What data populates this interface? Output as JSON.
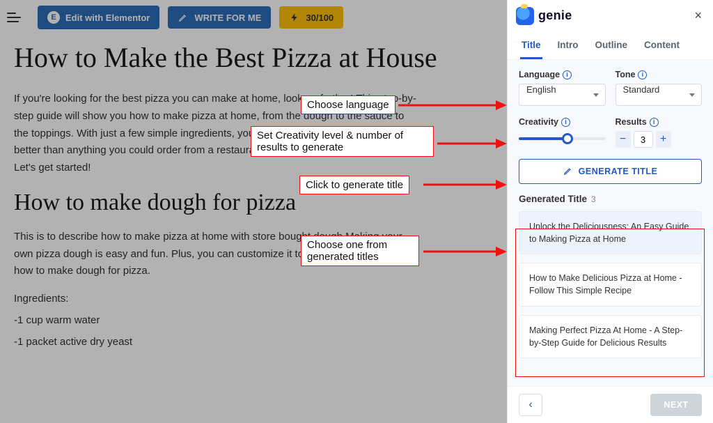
{
  "topbar": {
    "elementor_label": "Edit with Elementor",
    "write_label": "WRITE FOR ME",
    "credits_label": "30/100"
  },
  "article": {
    "title": "How to Make the Best Pizza at House",
    "intro": "If you're looking for the best pizza you can make at home, look no further! This step-by-step guide will show you how to make pizza at home, from the dough to the sauce to the toppings. With just a few simple ingredients, you can have a delicious pizza that's better than anything you could order from a restaurant. So what are you waiting for? Let's get started!",
    "h2": "How to make dough for pizza",
    "p2": "This is to describe how to make pizza at home with store bought dough Making your own pizza dough is easy and fun. Plus, you can customize it to your own taste. Here's how to make dough for pizza.",
    "ing_label": "Ingredients:",
    "ing1": "-1 cup warm water",
    "ing2": "-1 packet active dry yeast"
  },
  "panel": {
    "logo_text": "genie",
    "tabs": {
      "title": "Title",
      "intro": "Intro",
      "outline": "Outline",
      "content": "Content"
    },
    "language_label": "Language",
    "language_value": "English",
    "tone_label": "Tone",
    "tone_value": "Standard",
    "creativity_label": "Creativity",
    "creativity_value": 3,
    "creativity_max": 5,
    "results_label": "Results",
    "results_value": "3",
    "generate_btn": "GENERATE TITLE",
    "generated_heading": "Generated Title",
    "generated_count": "3",
    "generated": [
      "Unlock the Deliciousness: An Easy Guide to Making Pizza at Home",
      "How to Make Delicious Pizza at Home - Follow This Simple Recipe",
      "Making Perfect Pizza At Home - A Step-by-Step Guide for Delicious Results"
    ],
    "next_label": "NEXT"
  },
  "annotations": {
    "c1": "Choose language",
    "c2": "Set Creativity level & number of results to generate",
    "c3": "Click to generate title",
    "c4": "Choose one from generated titles"
  }
}
